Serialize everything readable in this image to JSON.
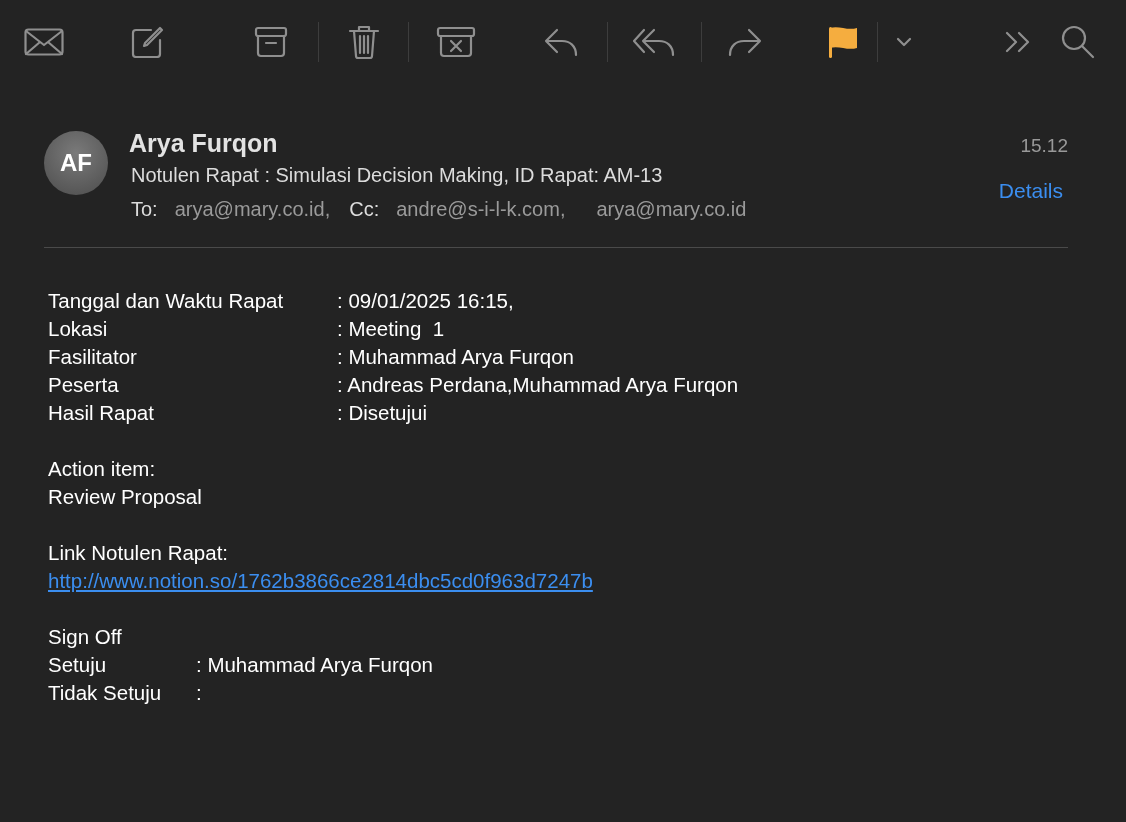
{
  "toolbar": {
    "flagged": true
  },
  "message": {
    "avatar_initials": "AF",
    "sender": "Arya Furqon",
    "time": "15.12",
    "subject": "Notulen Rapat : Simulasi Decision Making, ID Rapat: AM-13",
    "to_label": "To:",
    "to": [
      "arya@mary.co.id,"
    ],
    "cc_label": "Cc:",
    "cc": [
      "andre@s-i-l-k.com,",
      "arya@mary.co.id"
    ],
    "details": "Details"
  },
  "body": {
    "details": [
      {
        "label": "Tanggal dan Waktu Rapat",
        "value": ": 09/01/2025 16:15,"
      },
      {
        "label": "Lokasi",
        "value": ": Meeting  1"
      },
      {
        "label": "Fasilitator",
        "value": ": Muhammad Arya Furqon"
      },
      {
        "label": "Peserta",
        "value": ": Andreas Perdana,Muhammad Arya Furqon"
      },
      {
        "label": "Hasil Rapat",
        "value": ": Disetujui"
      }
    ],
    "action_heading": "Action item:",
    "action_items": [
      "Review Proposal"
    ],
    "link_heading": "Link Notulen Rapat:",
    "link": "http://www.notion.so/1762b3866ce2814dbc5cd0f963d7247b",
    "signoff_heading": "Sign Off",
    "signoff": [
      {
        "label": "Setuju",
        "value": ": Muhammad Arya Furqon"
      },
      {
        "label": "Tidak Setuju",
        "value": ":"
      }
    ]
  }
}
